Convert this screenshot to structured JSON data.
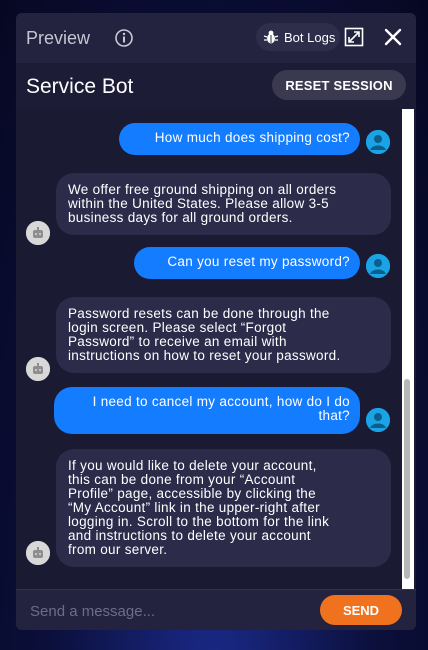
{
  "preview": {
    "title": "Preview",
    "bot_logs_label": "Bot Logs"
  },
  "header": {
    "title": "Service Bot",
    "reset_label": "RESET SESSION"
  },
  "messages": [
    {
      "sender": "user",
      "text": "How much does shipping cost?"
    },
    {
      "sender": "bot",
      "text": "We offer free ground shipping on all orders\nwithin the United States. Please allow 3-5\nbusiness days for all ground orders."
    },
    {
      "sender": "user",
      "text": "Can you reset my password?"
    },
    {
      "sender": "bot",
      "text": "Password resets can be done through the\nlogin screen. Please select “Forgot\nPassword” to receive an email with\ninstructions on how to reset your password."
    },
    {
      "sender": "user",
      "text": "I need to cancel my account, how do I do\nthat?"
    },
    {
      "sender": "bot",
      "text": "If you would like to delete your account,\nthis can be done from your “Account\nProfile” page, accessible by clicking the\n“My Account” link in the upper-right after\nlogging in. Scroll to the bottom for the link\nand instructions to delete your account\nfrom our server."
    }
  ],
  "input": {
    "placeholder": "Send a message...",
    "value": "",
    "send_label": "SEND"
  },
  "colors": {
    "user_bubble": "#147cff",
    "bot_bubble": "#2c2b4a",
    "send_button": "#f0721f",
    "user_avatar": "#1aa4e6"
  },
  "icons": [
    "info-icon",
    "bug-icon",
    "expand-icon",
    "close-icon",
    "user-avatar-icon",
    "bot-avatar-icon"
  ]
}
